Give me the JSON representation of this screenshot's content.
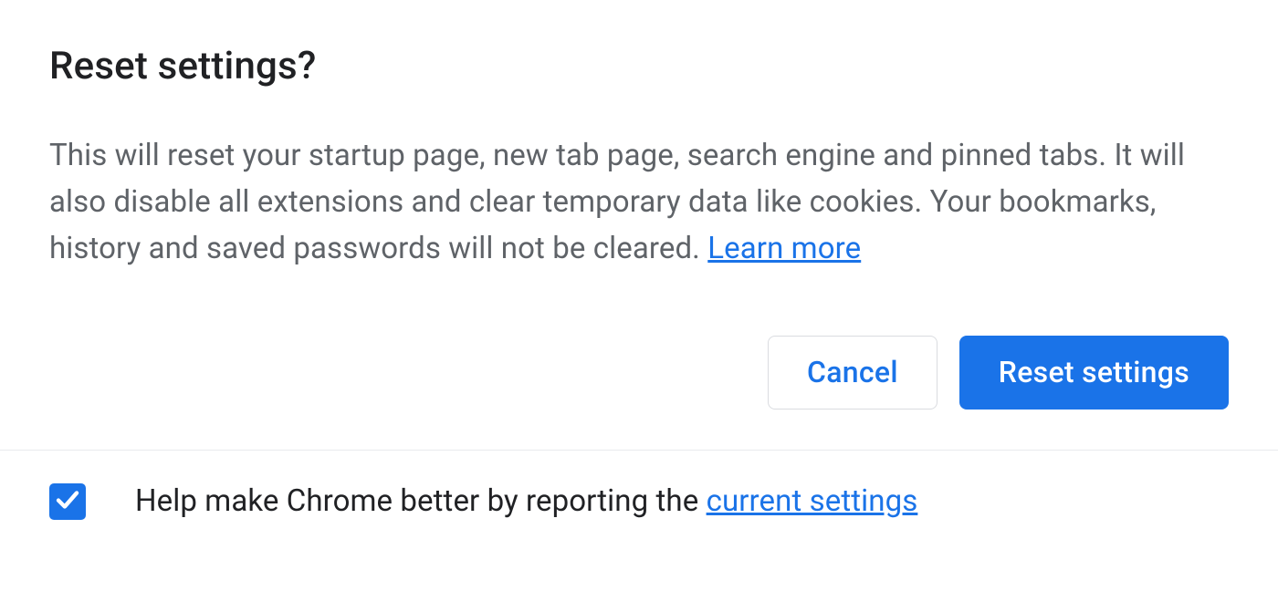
{
  "dialog": {
    "title": "Reset settings?",
    "body_text": "This will reset your startup page, new tab page, search engine and pinned tabs. It will also disable all extensions and clear temporary data like cookies. Your bookmarks, history and saved passwords will not be cleared. ",
    "learn_more": "Learn more",
    "buttons": {
      "cancel": "Cancel",
      "confirm": "Reset settings"
    },
    "footer": {
      "checked": true,
      "text_before": "Help make Chrome better by reporting the ",
      "link_text": "current settings"
    }
  },
  "colors": {
    "accent": "#1a73e8",
    "text_primary": "#202124",
    "text_secondary": "#5f6368",
    "border": "#dadce0"
  }
}
